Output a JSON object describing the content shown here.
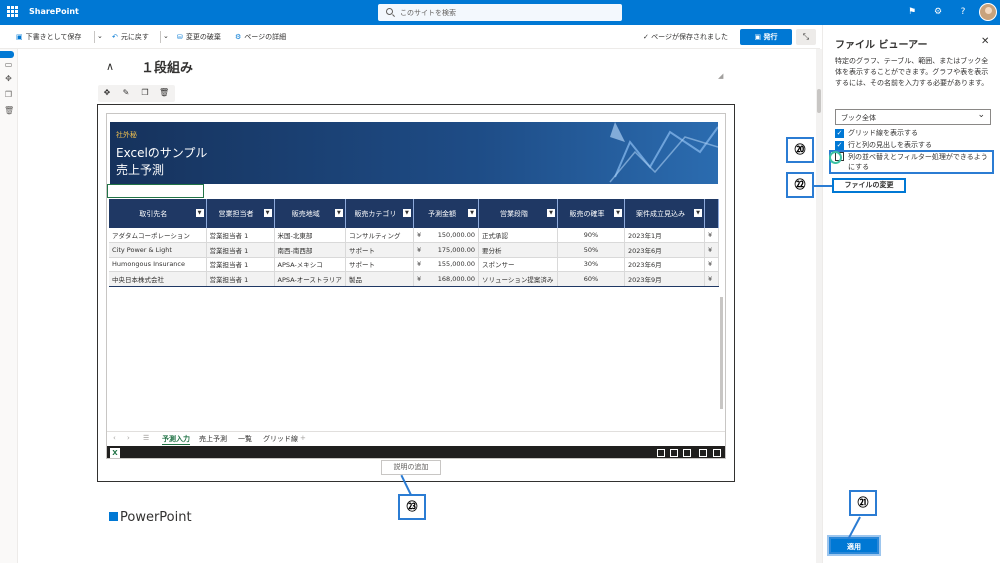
{
  "topbar": {
    "brand": "SharePoint",
    "search_placeholder": "このサイトを検索"
  },
  "cmdbar": {
    "save_draft": "下書きとして保存",
    "undo": "元に戻す",
    "discard": "変更の破棄",
    "page_details": "ページの詳細",
    "saved_status": "ページが保存されました",
    "publish": "発行"
  },
  "section": {
    "title": "１段組み"
  },
  "excel": {
    "confidential": "社外秘",
    "title_line1": "Excelのサンプル",
    "title_line2": "売上予測",
    "columns": [
      "取引先名",
      "営業担当者",
      "販売地域",
      "販売カテゴリ",
      "予測金額",
      "営業段階",
      "販売の確率",
      "案件成立見込み"
    ],
    "rows": [
      [
        "アダタムコーポレーション",
        "営業担当者 1",
        "米国-北東部",
        "コンサルティング",
        "¥",
        "150,000.00",
        "正式承認",
        "90%",
        "2023年1月",
        "¥"
      ],
      [
        "City Power & Light",
        "営業担当者 1",
        "南西-南西部",
        "サポート",
        "¥",
        "175,000.00",
        "要分析",
        "50%",
        "2023年6月",
        "¥"
      ],
      [
        "Humongous Insurance",
        "営業担当者 1",
        "APSA-メキシコ",
        "サポート",
        "¥",
        "155,000.00",
        "スポンサー",
        "30%",
        "2023年6月",
        "¥"
      ],
      [
        "中央日本株式会社",
        "営業担当者 1",
        "APSA-オーストラリア",
        "製品",
        "¥",
        "168,000.00",
        "ソリューション提案済み",
        "60%",
        "2023年9月",
        "¥"
      ]
    ],
    "sheet_tabs": [
      "予測入力",
      "売上予測",
      "一覧",
      "グリッド線"
    ],
    "add_sheet": "+"
  },
  "caption_placeholder": "説明の追加",
  "ppt_heading": "PowerPoint",
  "panel": {
    "title": "ファイル ビューアー",
    "description": "特定のグラフ、テーブル、範囲、またはブック全体を表示することができます。グラフや表を表示するには、その名前を入力する必要があります。",
    "select_value": "ブック全体",
    "checkbox_gridlines": "グリッド線を表示する",
    "checkbox_headers": "行と列の見出しを表示する",
    "checkbox_sortfilter": "列の並べ替えとフィルター処理ができるようにする",
    "change_file": "ファイルの変更",
    "apply": "適用"
  },
  "callouts": {
    "c20": "⑳",
    "c21": "㉑",
    "c22": "㉒",
    "c23": "㉓"
  },
  "colors": {
    "accent": "#0078d4",
    "excel_header": "#1f3864",
    "excel_green": "#217346",
    "callout_border": "#2b7cd3"
  }
}
